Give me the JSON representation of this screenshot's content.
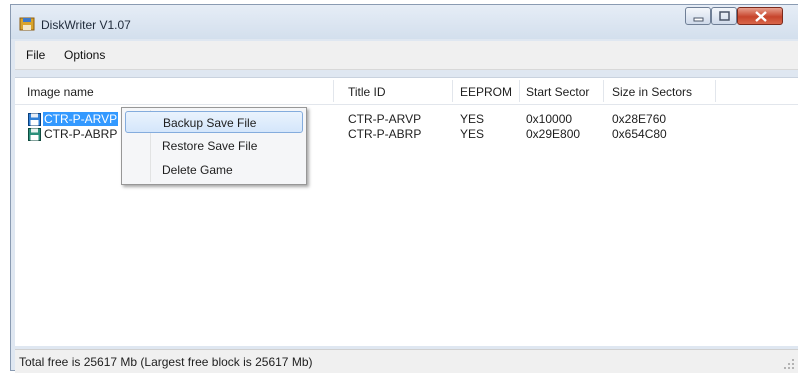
{
  "window": {
    "title": "DiskWriter V1.07",
    "app_icon": "floppy-disk-icon"
  },
  "menu": {
    "items": [
      {
        "label": "File"
      },
      {
        "label": "Options"
      }
    ]
  },
  "list": {
    "columns": [
      "Image name",
      "Title ID",
      "EEPROM",
      "Start Sector",
      "Size in Sectors"
    ],
    "rows": [
      {
        "image_name": "CTR-P-ARVP",
        "title_id": "CTR-P-ARVP",
        "eeprom": "YES",
        "start_sector": "0x10000",
        "size_in_sectors": "0x28E760",
        "selected": true,
        "icon": "disk-image-icon"
      },
      {
        "image_name": "CTR-P-ABRP",
        "title_id": "CTR-P-ABRP",
        "eeprom": "YES",
        "start_sector": "0x29E800",
        "size_in_sectors": "0x654C80",
        "selected": false,
        "icon": "disk-image-icon"
      }
    ]
  },
  "context_menu": {
    "items": [
      {
        "label": "Backup Save File",
        "highlighted": true
      },
      {
        "label": "Restore Save File",
        "highlighted": false
      },
      {
        "label": "Delete Game",
        "highlighted": false
      }
    ]
  },
  "status": {
    "text": "Total free is 25617 Mb  (Largest free block is 25617 Mb)"
  },
  "colors": {
    "selection": "#3399ff",
    "close_button": "#c7452c",
    "window_frame": "#dfe7f1"
  }
}
